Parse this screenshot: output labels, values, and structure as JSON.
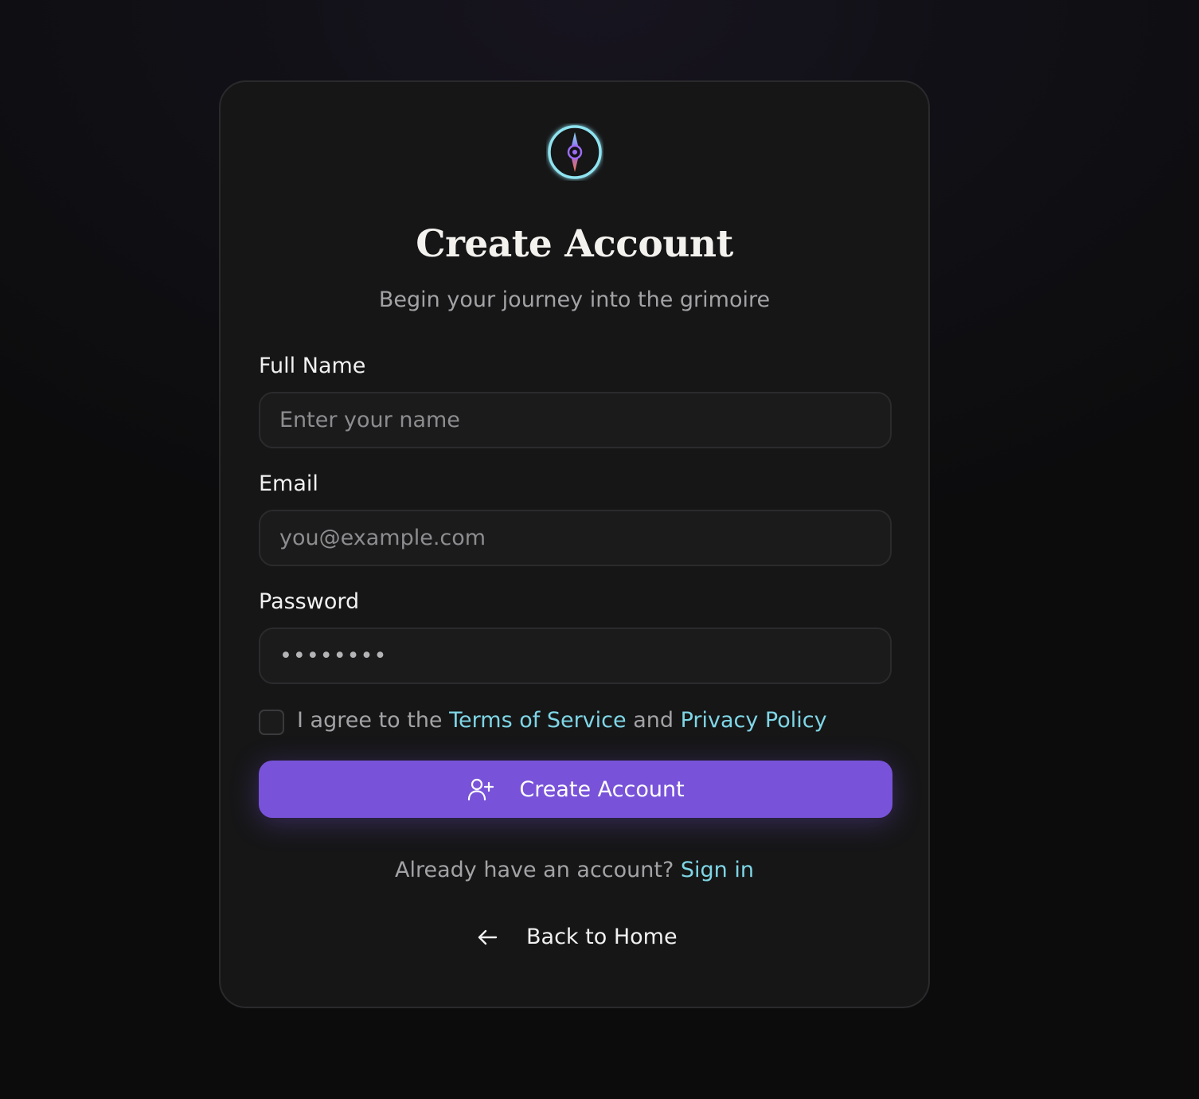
{
  "header": {
    "logo_icon": "compass-icon",
    "title": "Create Account",
    "subtitle": "Begin your journey into the grimoire"
  },
  "form": {
    "full_name": {
      "label": "Full Name",
      "placeholder": "Enter your name",
      "value": ""
    },
    "email": {
      "label": "Email",
      "placeholder": "you@example.com",
      "value": ""
    },
    "password": {
      "label": "Password",
      "placeholder": "••••••••",
      "value": ""
    },
    "terms": {
      "checked": false,
      "prefix": "I agree to the ",
      "terms_link": "Terms of Service",
      "conjunction": " and ",
      "privacy_link": "Privacy Policy"
    },
    "submit": {
      "label": "Create Account",
      "icon": "user-plus-icon"
    }
  },
  "footer": {
    "signin_prompt": "Already have an account? ",
    "signin_link": "Sign in",
    "back_label": "Back to Home",
    "back_icon": "arrow-left-icon"
  },
  "colors": {
    "accent": "#7853d9",
    "link": "#7fd6e6",
    "card_bg": "#161617",
    "page_bg": "#0c0c0d"
  }
}
